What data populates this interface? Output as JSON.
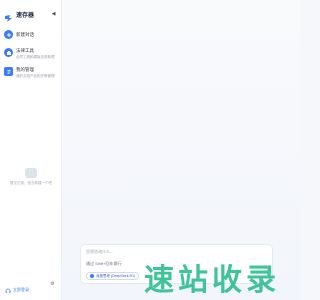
{
  "app": {
    "name": "速存器"
  },
  "sidebar": {
    "collapse_icon": "chevron-left-icon",
    "items": [
      {
        "title": "新建对话",
        "subtitle": "",
        "icon": "plus-icon",
        "color": "#3a7bfd"
      },
      {
        "title": "法律工具",
        "subtitle": "合同工具和模板法务助理",
        "icon": "briefcase-icon",
        "color": "#3a7bfd"
      },
      {
        "title": "我的管理",
        "subtitle": "我的文档产品相关等管理",
        "icon": "document-icon",
        "color": "#3a7bfd"
      }
    ],
    "empty_state": "暂无记录，快去新建一个吧",
    "footer": {
      "user_label": "立即登录",
      "settings_icon": "settings-icon"
    }
  },
  "composer": {
    "placeholder": "您想咨询什么...",
    "hint": "通过 Shift+回车换行",
    "model_label": "深度思考 (DeepSeek-R1)"
  },
  "watermark": {
    "text": "速站收录",
    "color": "#2fbf8f"
  }
}
